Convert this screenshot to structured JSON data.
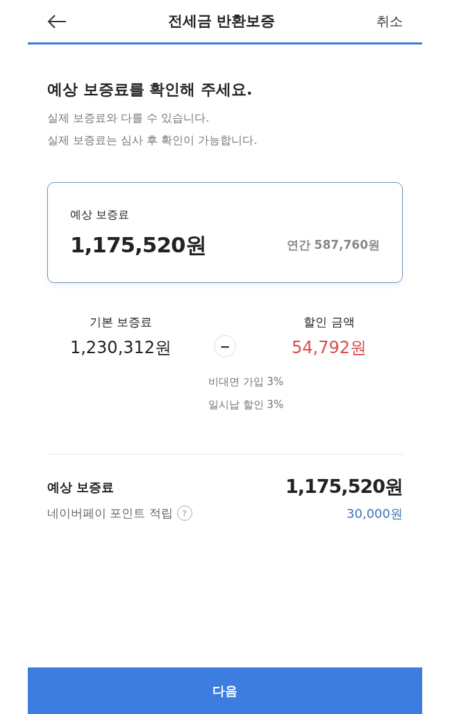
{
  "header": {
    "title": "전세금 반환보증",
    "cancel": "취소"
  },
  "intro": {
    "heading": "예상 보증료를 확인해 주세요.",
    "notes": [
      "실제 보증료와 다를 수 있습니다.",
      "실제 보증료는 심사 후 확인이 가능합니다."
    ]
  },
  "estimate_card": {
    "label": "예상 보증료",
    "amount": "1,175,520원",
    "annual": "연간 587,760원"
  },
  "breakdown": {
    "base": {
      "label": "기본 보증료",
      "amount": "1,230,312원"
    },
    "operator": "−",
    "discount": {
      "label": "할인 금액",
      "amount": "54,792원"
    },
    "discount_items": [
      "비대면 가입 3%",
      "일시납 할인 3%"
    ]
  },
  "summary": {
    "label": "예상 보증료",
    "amount": "1,175,520원",
    "points_label": "네이버페이 포인트 적립",
    "help": "?",
    "points": "30,000원"
  },
  "next_button": "다음"
}
